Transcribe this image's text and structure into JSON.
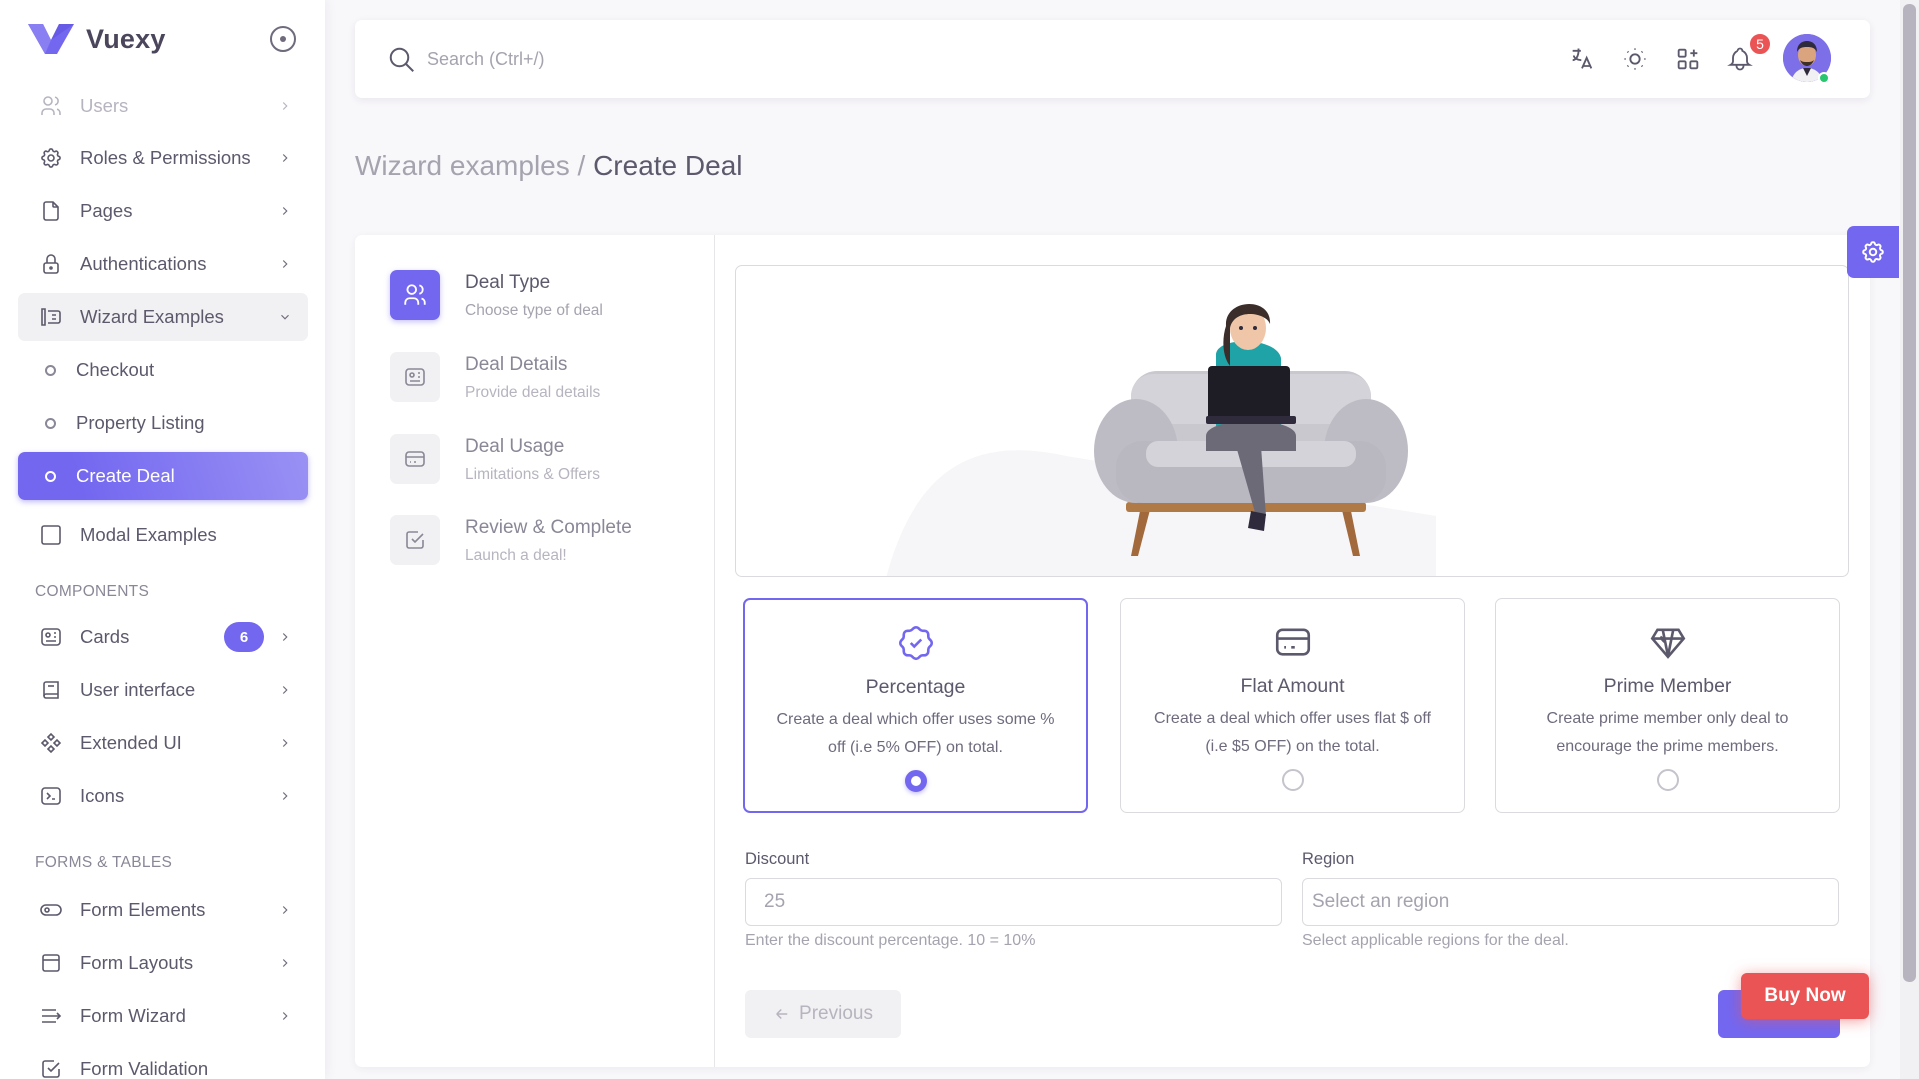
{
  "brand": {
    "name": "Vuexy",
    "color": "#7367f0"
  },
  "sidebar": {
    "items": [
      {
        "label": "Users",
        "icon": "users-icon"
      },
      {
        "label": "Roles & Permissions",
        "icon": "settings-icon"
      },
      {
        "label": "Pages",
        "icon": "file-icon"
      },
      {
        "label": "Authentications",
        "icon": "lock-icon"
      },
      {
        "label": "Wizard Examples",
        "icon": "wizard-icon"
      },
      {
        "label": "Checkout"
      },
      {
        "label": "Property Listing"
      },
      {
        "label": "Create Deal"
      },
      {
        "label": "Modal Examples",
        "icon": "square-icon"
      }
    ],
    "components_header": "COMPONENTS",
    "components": [
      {
        "label": "Cards",
        "badge": "6",
        "icon": "id-card-icon"
      },
      {
        "label": "User interface",
        "icon": "notebook-icon"
      },
      {
        "label": "Extended UI",
        "icon": "components-icon"
      },
      {
        "label": "Icons",
        "icon": "terminal-icon"
      }
    ],
    "forms_header": "FORMS & TABLES",
    "forms": [
      {
        "label": "Form Elements",
        "icon": "toggle-icon"
      },
      {
        "label": "Form Layouts",
        "icon": "layout-icon"
      },
      {
        "label": "Form Wizard",
        "icon": "list-arrow-icon"
      },
      {
        "label": "Form Validation",
        "icon": "checkbox-icon"
      }
    ]
  },
  "topbar": {
    "search_placeholder": "Search (Ctrl+/)",
    "notification_count": "5"
  },
  "breadcrumb": {
    "parent": "Wizard examples /",
    "current": "Create Deal"
  },
  "steps": [
    {
      "title": "Deal Type",
      "subtitle": "Choose type of deal"
    },
    {
      "title": "Deal Details",
      "subtitle": "Provide deal details"
    },
    {
      "title": "Deal Usage",
      "subtitle": "Limitations & Offers"
    },
    {
      "title": "Review & Complete",
      "subtitle": "Launch a deal!"
    }
  ],
  "options": [
    {
      "title": "Percentage",
      "desc": "Create a deal which offer uses some % off (i.e 5% OFF) on total.",
      "selected": true
    },
    {
      "title": "Flat Amount",
      "desc": "Create a deal which offer uses flat $ off (i.e $5 OFF) on the total.",
      "selected": false
    },
    {
      "title": "Prime Member",
      "desc": "Create prime member only deal to encourage the prime members.",
      "selected": false
    }
  ],
  "form": {
    "discount_label": "Discount",
    "discount_placeholder": "25",
    "discount_help": "Enter the discount percentage. 10 = 10%",
    "region_label": "Region",
    "region_placeholder": "Select an region",
    "region_help": "Select applicable regions for the deal."
  },
  "buttons": {
    "previous": "Previous",
    "buy_now": "Buy Now"
  }
}
